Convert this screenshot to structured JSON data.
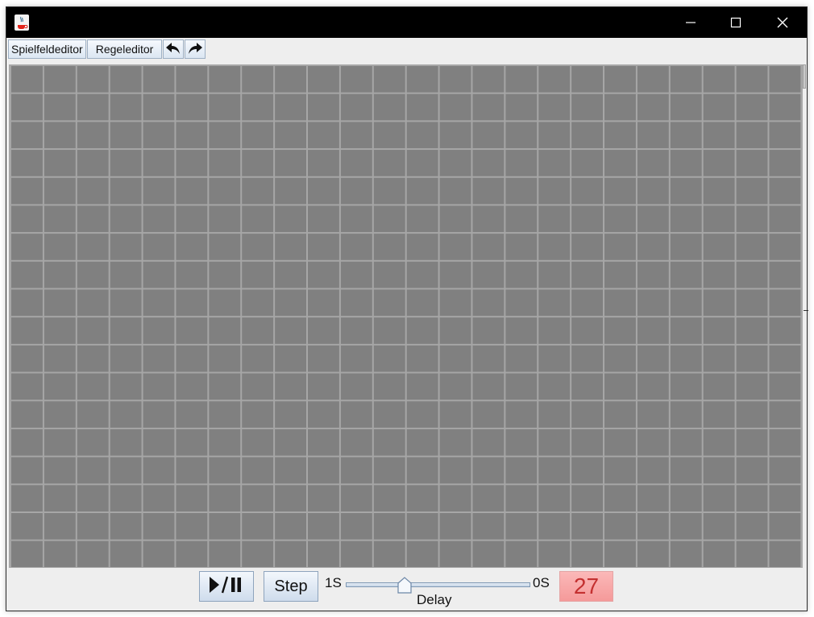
{
  "window": {
    "icon": "java-coffee-icon",
    "controls": {
      "minimize_icon": "minimize-icon",
      "maximize_icon": "maximize-icon",
      "close_icon": "close-icon"
    }
  },
  "toolbar": {
    "spielfeld_label": "Spielfeldeditor",
    "regel_label": "Regeleditor",
    "undo_icon": "undo-arrow-icon",
    "redo_icon": "redo-arrow-icon"
  },
  "board": {
    "columns": 24,
    "rows": 18,
    "cell_color": "#808080",
    "grid_color": "#a6a6a6"
  },
  "controls": {
    "play_pause_icon": "play-pause-icon",
    "step_label": "Step",
    "slider": {
      "min_label": "1S",
      "max_label": "0S",
      "caption": "Delay",
      "value_fraction": 0.32
    },
    "counter_value": "27",
    "counter_color": "#c43030"
  }
}
